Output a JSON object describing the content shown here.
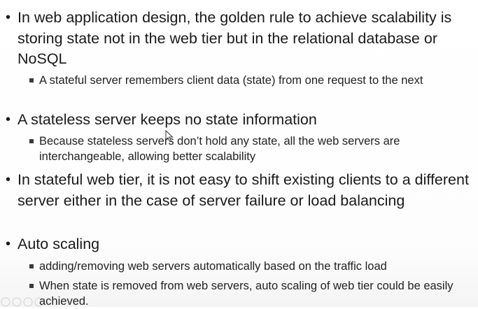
{
  "bullets": [
    {
      "text": "In web application design, the golden rule to achieve scalability is storing state not in the web tier but in the relational database or NoSQL",
      "subs": [
        "A stateful server remembers client data (state) from one request to the next"
      ]
    },
    {
      "text": "A stateless server keeps no state information",
      "subs": [
        "Because stateless servers don’t hold any state, all the web servers are interchangeable, allowing better scalability"
      ]
    },
    {
      "text": "In stateful web tier, it is not easy to shift existing clients to a different server either in the case of server failure or load balancing",
      "subs": []
    },
    {
      "text": "Auto scaling",
      "subs": [
        "adding/removing web servers automatically based on the traffic load",
        "When state is removed from web servers, auto scaling of web tier could be easily achieved."
      ]
    }
  ],
  "icons": {
    "bullet": "round-bullet",
    "sub_bullet": "square-bullet",
    "cursor": "mouse-pointer-icon"
  }
}
